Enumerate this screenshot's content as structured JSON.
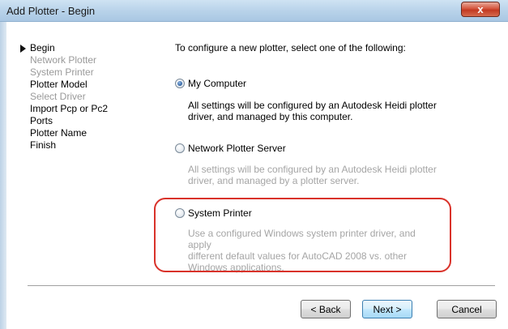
{
  "window": {
    "title": "Add Plotter - Begin",
    "close_glyph": "x"
  },
  "nav": {
    "items": [
      {
        "label": "Begin",
        "state": "active"
      },
      {
        "label": "Network Plotter",
        "state": "inactive"
      },
      {
        "label": "System Printer",
        "state": "inactive"
      },
      {
        "label": "Plotter Model",
        "state": "normal"
      },
      {
        "label": "Select Driver",
        "state": "inactive"
      },
      {
        "label": "Import Pcp or Pc2",
        "state": "normal"
      },
      {
        "label": "Ports",
        "state": "normal"
      },
      {
        "label": "Plotter Name",
        "state": "normal"
      },
      {
        "label": "Finish",
        "state": "normal"
      }
    ]
  },
  "main": {
    "intro": "To configure a new plotter, select one of the following:",
    "options": [
      {
        "label": "My Computer",
        "selected": true,
        "desc_lines": [
          "All settings will be configured by an Autodesk Heidi plotter",
          "driver, and managed by this computer."
        ]
      },
      {
        "label": "Network Plotter Server",
        "selected": false,
        "desc_lines": [
          "All settings will be configured by an Autodesk Heidi plotter",
          "driver, and managed by a plotter server."
        ]
      },
      {
        "label": "System Printer",
        "selected": false,
        "desc_lines": [
          "Use a configured Windows system printer driver, and apply",
          "different default values for AutoCAD 2008 vs. other",
          "Windows applications."
        ]
      }
    ]
  },
  "buttons": {
    "back": "< Back",
    "next": "Next >",
    "cancel": "Cancel"
  },
  "colors": {
    "highlight": "#d9322a",
    "disabled_text": "#a5a5a5"
  }
}
